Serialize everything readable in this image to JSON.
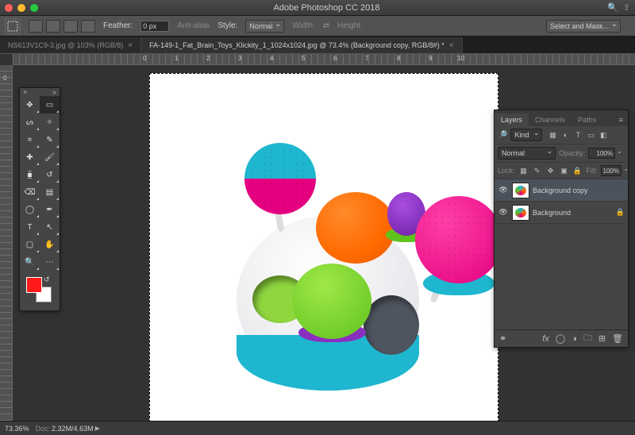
{
  "app": {
    "title": "Adobe Photoshop CC 2018"
  },
  "options": {
    "feather_label": "Feather:",
    "feather_value": "0 px",
    "anti_alias": "Anti-alias",
    "style_label": "Style:",
    "style_value": "Normal",
    "width_label": "Width:",
    "height_label": "Height:",
    "select_and_mask": "Select and Mask..."
  },
  "tabs": [
    {
      "label": "NS613V1C9-3.jpg @ 103% (RGB/8)",
      "active": false
    },
    {
      "label": "FA-149-1_Fat_Brain_Toys_Klickity_1_1024x1024.jpg @ 73.4% (Background copy, RGB/8#) *",
      "active": true
    }
  ],
  "ruler_h": [
    "0",
    "1",
    "2",
    "3",
    "4",
    "5",
    "6",
    "7",
    "8",
    "9",
    "10"
  ],
  "ruler_v": [
    "0"
  ],
  "tools": [
    "move-tool",
    "rectangular-marquee-tool",
    "lasso-tool",
    "magic-wand-tool",
    "crop-tool",
    "eyedropper-tool",
    "spot-healing-tool",
    "brush-tool",
    "clone-stamp-tool",
    "history-brush-tool",
    "eraser-tool",
    "gradient-tool",
    "dodge-tool",
    "pen-tool",
    "type-tool",
    "path-selection-tool",
    "rectangle-tool",
    "hand-tool",
    "zoom-tool",
    "edit-toolbar"
  ],
  "tools_selected": "rectangular-marquee-tool",
  "swatch": {
    "fg": "#ff1a1a",
    "bg": "#ffffff"
  },
  "layers_panel": {
    "tabs": [
      "Layers",
      "Channels",
      "Paths"
    ],
    "active_tab": "Layers",
    "filter_label": "Kind",
    "blend_mode": "Normal",
    "opacity_label": "Opacity:",
    "opacity_value": "100%",
    "lock_label": "Lock:",
    "fill_label": "Fill:",
    "fill_value": "100%",
    "layers": [
      {
        "name": "Background copy",
        "visible": true,
        "active": true,
        "locked": false
      },
      {
        "name": "Background",
        "visible": true,
        "active": false,
        "locked": true
      }
    ]
  },
  "status": {
    "zoom": "73.36%",
    "doc_label": "Doc:",
    "doc_value": "2.32M/4.63M"
  }
}
